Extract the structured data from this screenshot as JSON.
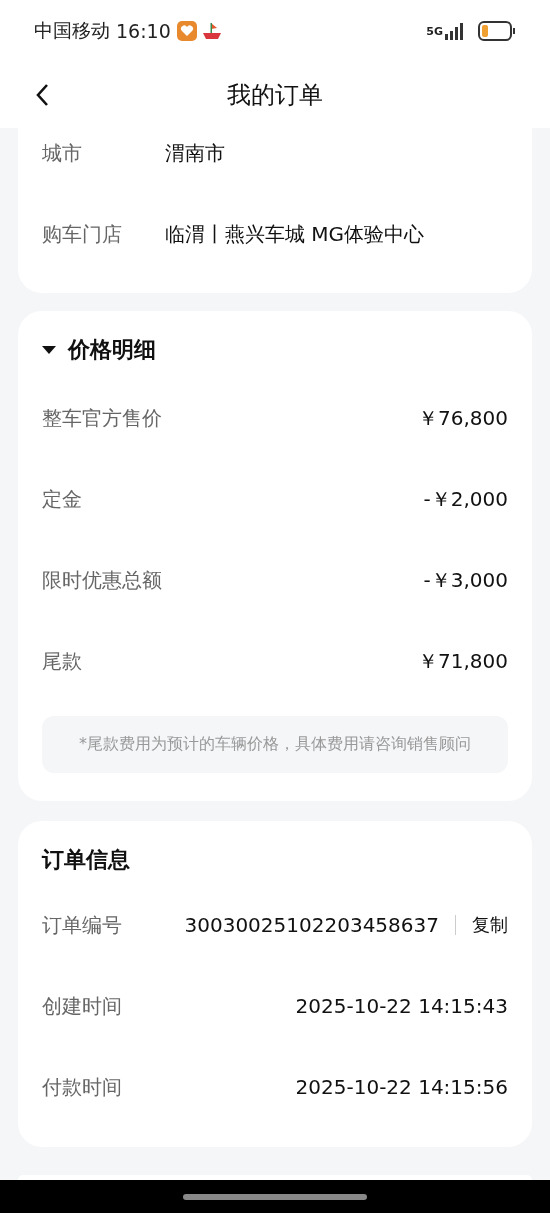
{
  "status_bar": {
    "carrier": "中国移动",
    "time": "16:10",
    "network": "5G"
  },
  "header": {
    "title": "我的订单"
  },
  "sections": [
    {
      "kind": "details",
      "rows": [
        {
          "label": "城市",
          "value": "渭南市"
        },
        {
          "label": "购车门店",
          "value": "临渭丨燕兴车城 MG体验中心"
        }
      ]
    },
    {
      "kind": "prices",
      "title": "价格明细",
      "expanded": true,
      "rows": [
        {
          "label": "整车官方售价",
          "value": "￥76,800"
        },
        {
          "label": "定金",
          "value": "-￥2,000"
        },
        {
          "label": "限时优惠总额",
          "value": "-￥3,000"
        },
        {
          "label": "尾款",
          "value": "￥71,800"
        }
      ],
      "note": "*尾款费用为预计的车辆价格，具体费用请咨询销售顾问"
    },
    {
      "kind": "info",
      "title": "订单信息",
      "rows": [
        {
          "label": "订单编号",
          "value": "30030025102203458637",
          "action": "复制"
        },
        {
          "label": "创建时间",
          "value": "2025-10-22 14:15:43"
        },
        {
          "label": "付款时间",
          "value": "2025-10-22 14:15:56"
        }
      ]
    }
  ]
}
